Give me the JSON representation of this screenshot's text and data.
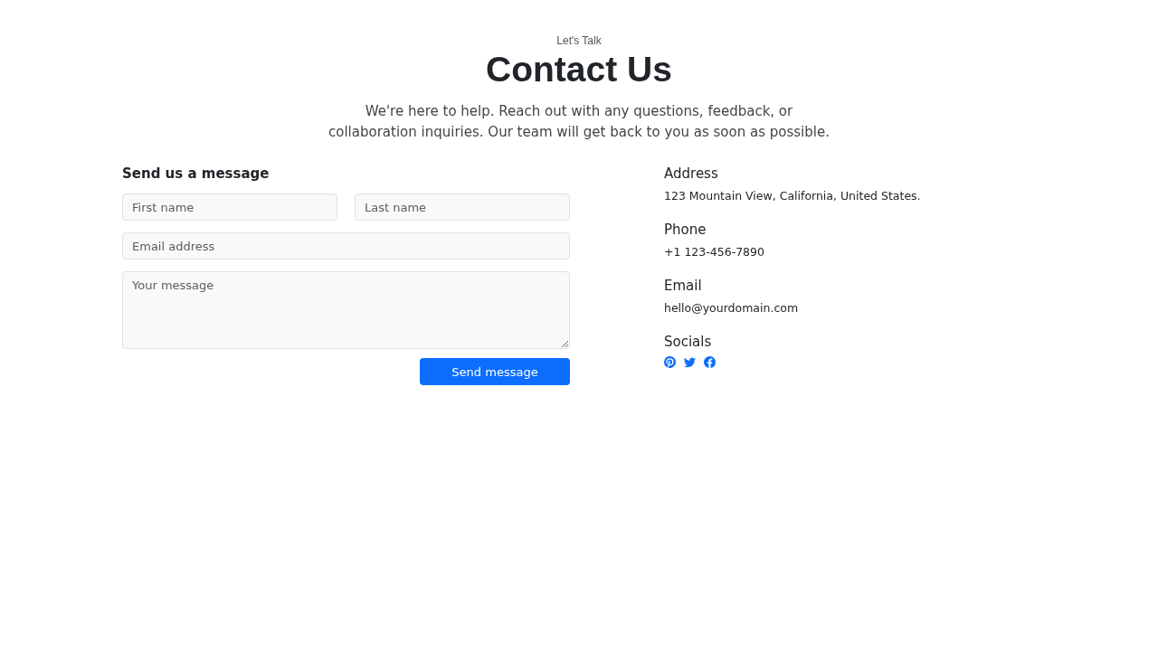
{
  "header": {
    "eyebrow": "Let's Talk",
    "title": "Contact Us",
    "intro": "We're here to help. Reach out with any questions, feedback, or collaboration inquiries. Our team will get back to you as soon as possible."
  },
  "form": {
    "title": "Send us a message",
    "fields": [
      {
        "kind": "input",
        "placeholder": "First name"
      },
      {
        "kind": "input",
        "placeholder": "Last name"
      },
      {
        "kind": "input",
        "placeholder": "Email address"
      },
      {
        "kind": "textarea",
        "placeholder": "Your message"
      }
    ],
    "submit": "Send message"
  },
  "info": [
    {
      "heading": "Address",
      "text": "123 Mountain View, California, United States."
    },
    {
      "heading": "Phone",
      "text": "+1 123-456-7890"
    },
    {
      "heading": "Email",
      "text": "hello@yourdomain.com"
    }
  ],
  "socials": {
    "heading": "Socials",
    "icons": [
      {
        "kind": "pinterest"
      },
      {
        "kind": "twitter"
      },
      {
        "kind": "facebook"
      }
    ]
  }
}
